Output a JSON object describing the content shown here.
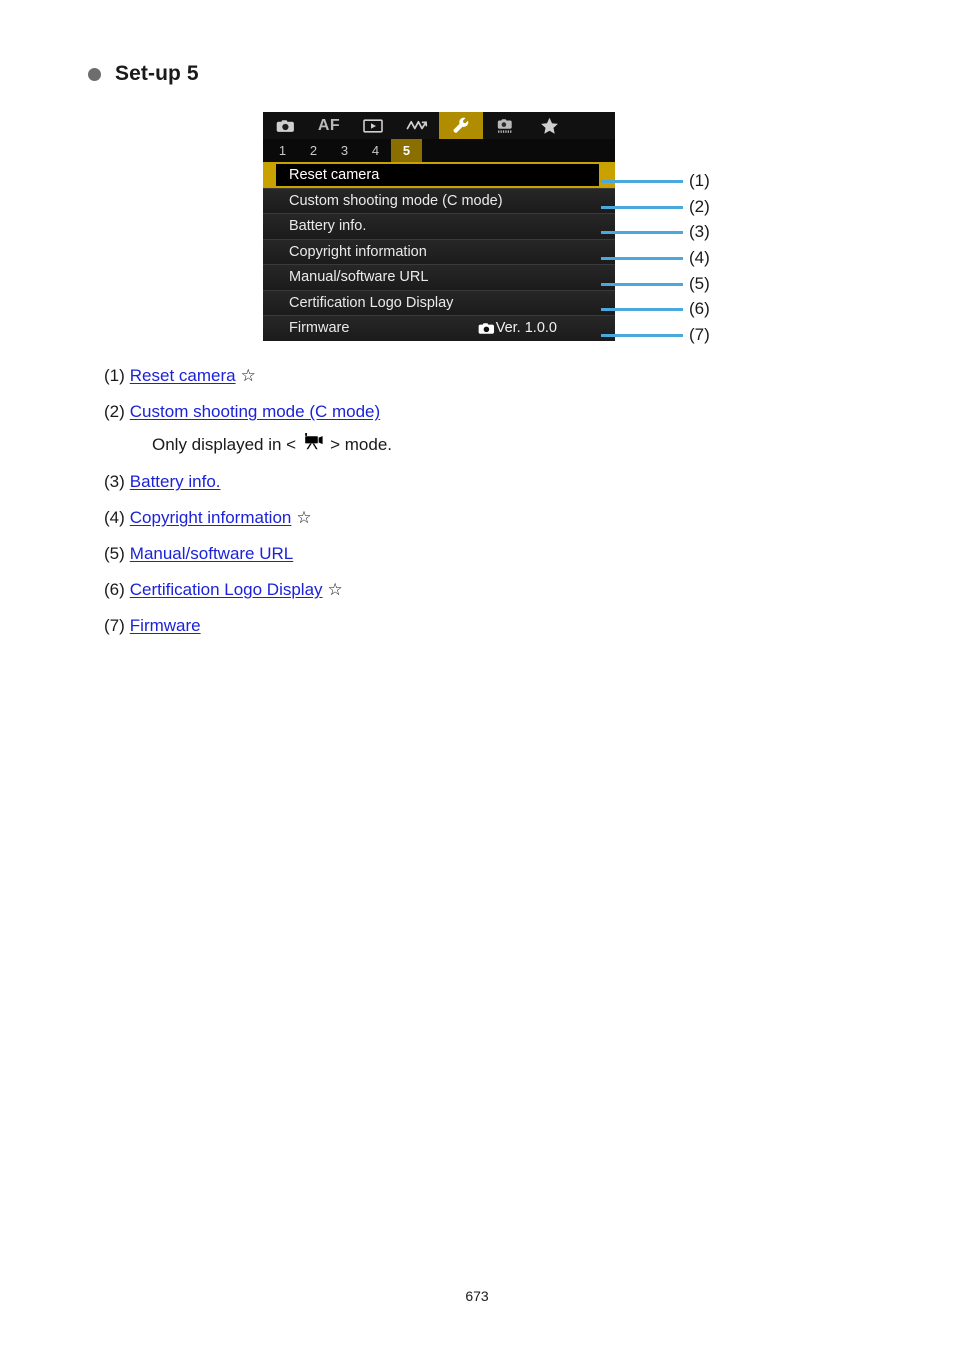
{
  "heading": {
    "bullet": "bullet-dot",
    "title": "Set-up 5"
  },
  "camera_menu": {
    "tabs": [
      {
        "name": "shooting-tab",
        "icon": "camera-icon",
        "label": "",
        "active": false
      },
      {
        "name": "af-tab",
        "icon": "af-text",
        "label": "AF",
        "active": false
      },
      {
        "name": "playback-tab",
        "icon": "play-box-icon",
        "label": "",
        "active": false
      },
      {
        "name": "wireless-tab",
        "icon": "wireless-wave-icon",
        "label": "",
        "active": false
      },
      {
        "name": "setup-tab",
        "icon": "wrench-icon",
        "label": "",
        "active": true
      },
      {
        "name": "custom-func-tab",
        "icon": "custom-camera-icon",
        "label": "",
        "active": false
      },
      {
        "name": "my-menu-tab",
        "icon": "star-icon",
        "label": "",
        "active": false
      }
    ],
    "page_numbers": [
      {
        "label": "1",
        "active": false
      },
      {
        "label": "2",
        "active": false
      },
      {
        "label": "3",
        "active": false
      },
      {
        "label": "4",
        "active": false
      },
      {
        "label": "5",
        "active": true
      }
    ],
    "items": [
      {
        "label": "Reset camera",
        "value": "",
        "selected": true
      },
      {
        "label": "Custom shooting mode (C mode)",
        "value": "",
        "selected": false
      },
      {
        "label": "Battery info.",
        "value": "",
        "selected": false
      },
      {
        "label": "Copyright information",
        "value": "",
        "selected": false
      },
      {
        "label": "Manual/software URL",
        "value": "",
        "selected": false
      },
      {
        "label": "Certification Logo Display",
        "value": "",
        "selected": false
      },
      {
        "label": "Firmware",
        "value": "Ver. 1.0.0",
        "selected": false
      }
    ],
    "firmware_icon": "camera-icon",
    "colors": {
      "accent_gold": "#c9a200",
      "tab_active": "#b08c00",
      "page_active": "#8a6e00",
      "callout_blue": "#4aa8dd",
      "menu_bg": "#000000"
    }
  },
  "callouts": [
    {
      "number": "(1)"
    },
    {
      "number": "(2)"
    },
    {
      "number": "(3)"
    },
    {
      "number": "(4)"
    },
    {
      "number": "(5)"
    },
    {
      "number": "(6)"
    },
    {
      "number": "(7)"
    }
  ],
  "references": [
    {
      "marker": "(1)",
      "link": "Reset camera",
      "star": true,
      "note": ""
    },
    {
      "marker": "(2)",
      "link": "Custom shooting mode (C mode)",
      "star": false,
      "note_prefix": "Only displayed in <",
      "note_suffix": "> mode.",
      "note_icon": "movie-camera-icon"
    },
    {
      "marker": "(3)",
      "link": "Battery info.",
      "star": false,
      "note": ""
    },
    {
      "marker": "(4)",
      "link": "Copyright information",
      "star": true,
      "note": ""
    },
    {
      "marker": "(5)",
      "link": "Manual/software URL",
      "star": false,
      "note": ""
    },
    {
      "marker": "(6)",
      "link": "Certification Logo Display",
      "star": true,
      "note": ""
    },
    {
      "marker": "(7)",
      "link": "Firmware",
      "star": false,
      "note": ""
    }
  ],
  "footer": {
    "page_number": "673"
  },
  "glyphs": {
    "star_outline": "☆"
  }
}
